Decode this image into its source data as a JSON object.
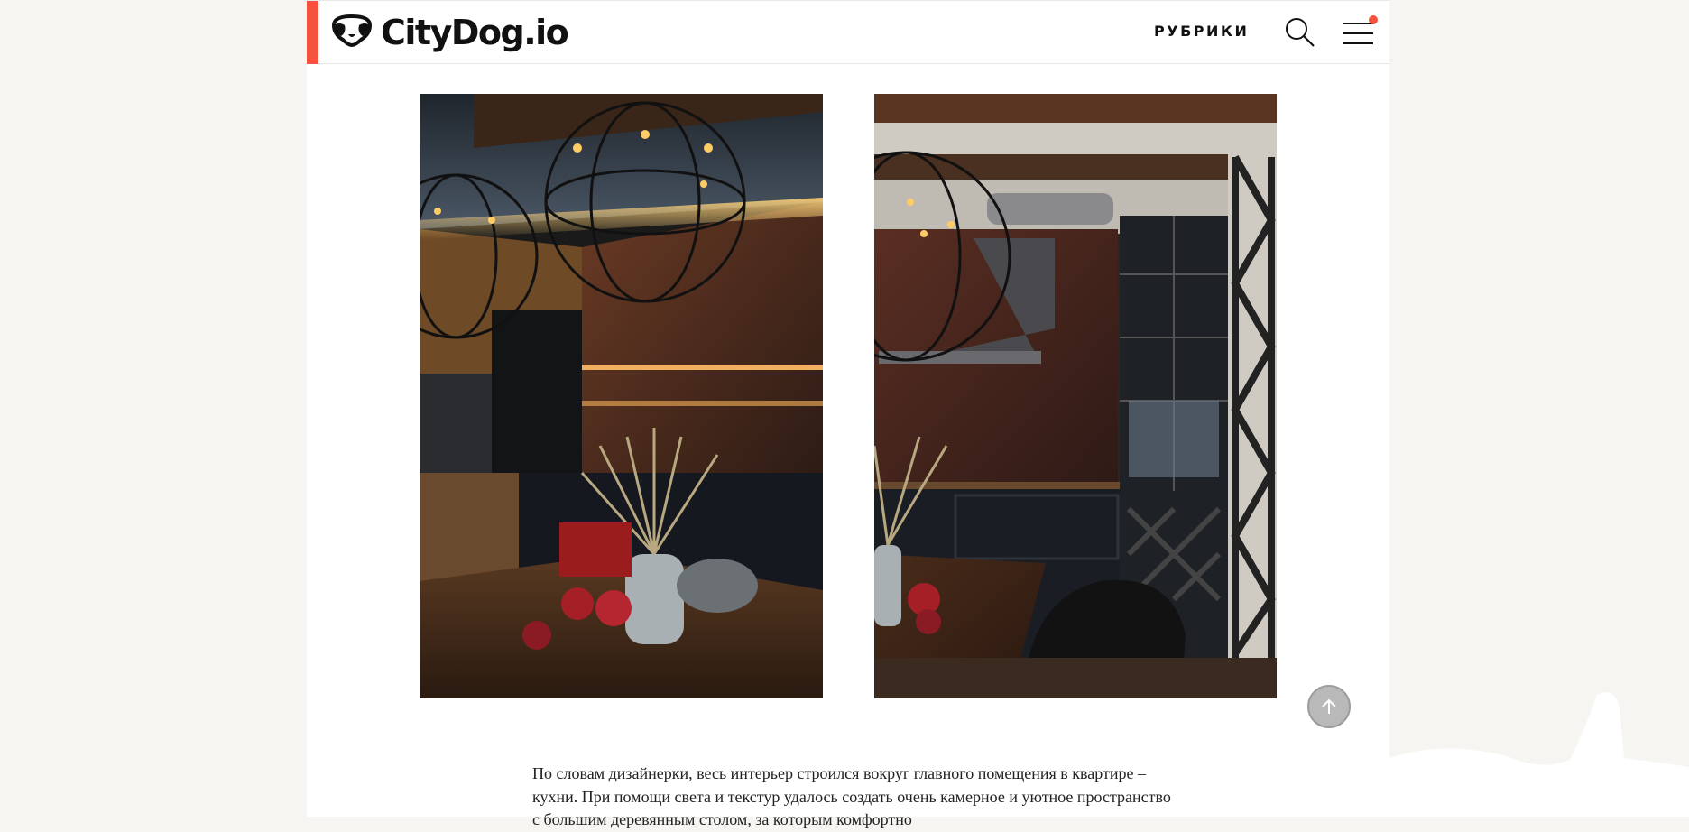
{
  "header": {
    "logo_text": "CityDog.io",
    "nav_label": "РУБРИКИ",
    "accent_color": "#f5533d",
    "icons": [
      "dog-face-logo-icon",
      "search-icon",
      "menu-icon",
      "notification-dot"
    ]
  },
  "gallery": {
    "images": [
      {
        "name": "kitchen-dining-photo-left"
      },
      {
        "name": "kitchen-wine-cabinet-photo-right"
      }
    ]
  },
  "scroll_top": {
    "icon": "arrow-up-icon"
  },
  "article": {
    "paragraph": "По словам дизайнерки, весь интерьер строился вокруг главного помещения в квартире – кухни. При помощи света и текстур удалось создать очень камерное и уютное пространство с большим деревянным столом, за которым комфортно"
  }
}
